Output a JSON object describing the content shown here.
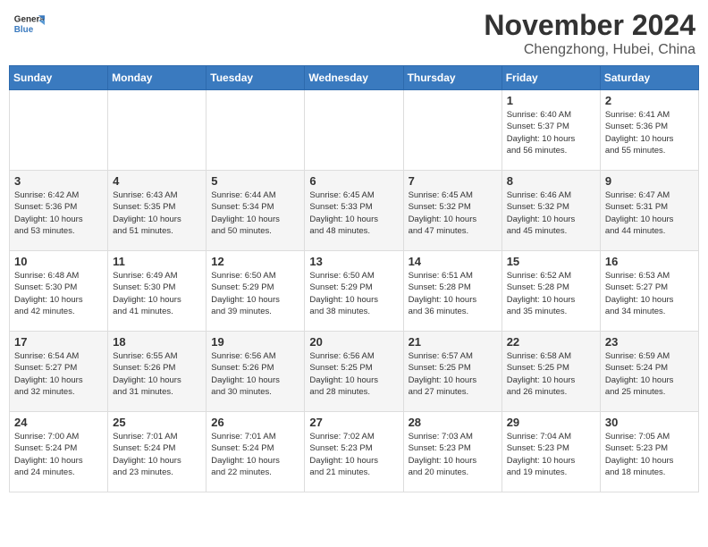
{
  "logo": {
    "text1": "General",
    "text2": "Blue"
  },
  "title": "November 2024",
  "location": "Chengzhong, Hubei, China",
  "weekdays": [
    "Sunday",
    "Monday",
    "Tuesday",
    "Wednesday",
    "Thursday",
    "Friday",
    "Saturday"
  ],
  "weeks": [
    [
      {
        "day": "",
        "info": ""
      },
      {
        "day": "",
        "info": ""
      },
      {
        "day": "",
        "info": ""
      },
      {
        "day": "",
        "info": ""
      },
      {
        "day": "",
        "info": ""
      },
      {
        "day": "1",
        "info": "Sunrise: 6:40 AM\nSunset: 5:37 PM\nDaylight: 10 hours\nand 56 minutes."
      },
      {
        "day": "2",
        "info": "Sunrise: 6:41 AM\nSunset: 5:36 PM\nDaylight: 10 hours\nand 55 minutes."
      }
    ],
    [
      {
        "day": "3",
        "info": "Sunrise: 6:42 AM\nSunset: 5:36 PM\nDaylight: 10 hours\nand 53 minutes."
      },
      {
        "day": "4",
        "info": "Sunrise: 6:43 AM\nSunset: 5:35 PM\nDaylight: 10 hours\nand 51 minutes."
      },
      {
        "day": "5",
        "info": "Sunrise: 6:44 AM\nSunset: 5:34 PM\nDaylight: 10 hours\nand 50 minutes."
      },
      {
        "day": "6",
        "info": "Sunrise: 6:45 AM\nSunset: 5:33 PM\nDaylight: 10 hours\nand 48 minutes."
      },
      {
        "day": "7",
        "info": "Sunrise: 6:45 AM\nSunset: 5:32 PM\nDaylight: 10 hours\nand 47 minutes."
      },
      {
        "day": "8",
        "info": "Sunrise: 6:46 AM\nSunset: 5:32 PM\nDaylight: 10 hours\nand 45 minutes."
      },
      {
        "day": "9",
        "info": "Sunrise: 6:47 AM\nSunset: 5:31 PM\nDaylight: 10 hours\nand 44 minutes."
      }
    ],
    [
      {
        "day": "10",
        "info": "Sunrise: 6:48 AM\nSunset: 5:30 PM\nDaylight: 10 hours\nand 42 minutes."
      },
      {
        "day": "11",
        "info": "Sunrise: 6:49 AM\nSunset: 5:30 PM\nDaylight: 10 hours\nand 41 minutes."
      },
      {
        "day": "12",
        "info": "Sunrise: 6:50 AM\nSunset: 5:29 PM\nDaylight: 10 hours\nand 39 minutes."
      },
      {
        "day": "13",
        "info": "Sunrise: 6:50 AM\nSunset: 5:29 PM\nDaylight: 10 hours\nand 38 minutes."
      },
      {
        "day": "14",
        "info": "Sunrise: 6:51 AM\nSunset: 5:28 PM\nDaylight: 10 hours\nand 36 minutes."
      },
      {
        "day": "15",
        "info": "Sunrise: 6:52 AM\nSunset: 5:28 PM\nDaylight: 10 hours\nand 35 minutes."
      },
      {
        "day": "16",
        "info": "Sunrise: 6:53 AM\nSunset: 5:27 PM\nDaylight: 10 hours\nand 34 minutes."
      }
    ],
    [
      {
        "day": "17",
        "info": "Sunrise: 6:54 AM\nSunset: 5:27 PM\nDaylight: 10 hours\nand 32 minutes."
      },
      {
        "day": "18",
        "info": "Sunrise: 6:55 AM\nSunset: 5:26 PM\nDaylight: 10 hours\nand 31 minutes."
      },
      {
        "day": "19",
        "info": "Sunrise: 6:56 AM\nSunset: 5:26 PM\nDaylight: 10 hours\nand 30 minutes."
      },
      {
        "day": "20",
        "info": "Sunrise: 6:56 AM\nSunset: 5:25 PM\nDaylight: 10 hours\nand 28 minutes."
      },
      {
        "day": "21",
        "info": "Sunrise: 6:57 AM\nSunset: 5:25 PM\nDaylight: 10 hours\nand 27 minutes."
      },
      {
        "day": "22",
        "info": "Sunrise: 6:58 AM\nSunset: 5:25 PM\nDaylight: 10 hours\nand 26 minutes."
      },
      {
        "day": "23",
        "info": "Sunrise: 6:59 AM\nSunset: 5:24 PM\nDaylight: 10 hours\nand 25 minutes."
      }
    ],
    [
      {
        "day": "24",
        "info": "Sunrise: 7:00 AM\nSunset: 5:24 PM\nDaylight: 10 hours\nand 24 minutes."
      },
      {
        "day": "25",
        "info": "Sunrise: 7:01 AM\nSunset: 5:24 PM\nDaylight: 10 hours\nand 23 minutes."
      },
      {
        "day": "26",
        "info": "Sunrise: 7:01 AM\nSunset: 5:24 PM\nDaylight: 10 hours\nand 22 minutes."
      },
      {
        "day": "27",
        "info": "Sunrise: 7:02 AM\nSunset: 5:23 PM\nDaylight: 10 hours\nand 21 minutes."
      },
      {
        "day": "28",
        "info": "Sunrise: 7:03 AM\nSunset: 5:23 PM\nDaylight: 10 hours\nand 20 minutes."
      },
      {
        "day": "29",
        "info": "Sunrise: 7:04 AM\nSunset: 5:23 PM\nDaylight: 10 hours\nand 19 minutes."
      },
      {
        "day": "30",
        "info": "Sunrise: 7:05 AM\nSunset: 5:23 PM\nDaylight: 10 hours\nand 18 minutes."
      }
    ]
  ]
}
